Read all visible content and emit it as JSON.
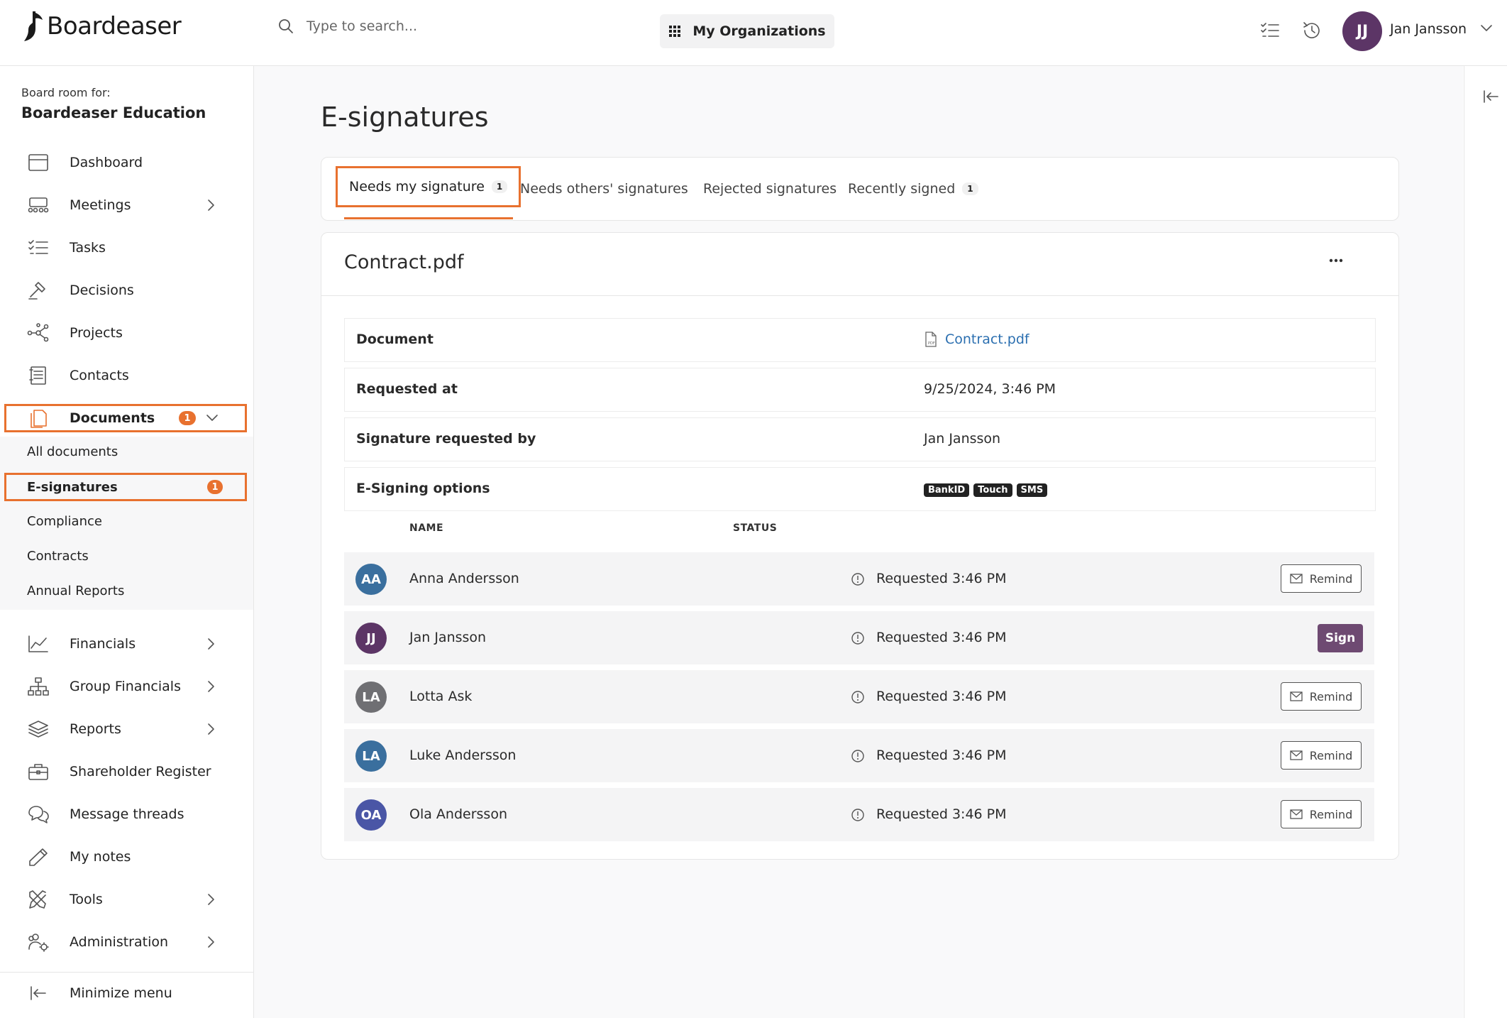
{
  "app": {
    "brand": "Boardeaser"
  },
  "header": {
    "search_placeholder": "Type to search...",
    "org_button": "My Organizations",
    "user": {
      "initials": "JJ",
      "name": "Jan Jansson",
      "avatar_color": "#5c3566"
    }
  },
  "sidebar": {
    "board_for_label": "Board room for:",
    "board_name": "Boardeaser Education",
    "items": [
      {
        "label": "Dashboard",
        "icon": "calendar-icon"
      },
      {
        "label": "Meetings",
        "icon": "meeting-icon",
        "expandable": true
      },
      {
        "label": "Tasks",
        "icon": "checklist-icon"
      },
      {
        "label": "Decisions",
        "icon": "gavel-icon"
      },
      {
        "label": "Projects",
        "icon": "network-icon"
      },
      {
        "label": "Contacts",
        "icon": "address-book-icon"
      },
      {
        "label": "Documents",
        "icon": "documents-icon",
        "badge": "1",
        "expanded": true,
        "selected": true
      },
      {
        "label": "Financials",
        "icon": "line-chart-icon",
        "expandable": true
      },
      {
        "label": "Group Financials",
        "icon": "org-chart-icon",
        "expandable": true
      },
      {
        "label": "Reports",
        "icon": "layers-icon",
        "expandable": true
      },
      {
        "label": "Shareholder Register",
        "icon": "briefcase-icon"
      },
      {
        "label": "Message threads",
        "icon": "chat-icon"
      },
      {
        "label": "My notes",
        "icon": "pencil-icon"
      },
      {
        "label": "Tools",
        "icon": "tools-icon",
        "expandable": true
      },
      {
        "label": "Administration",
        "icon": "users-gear-icon",
        "expandable": true
      }
    ],
    "documents_sub": [
      {
        "label": "All documents"
      },
      {
        "label": "E-signatures",
        "badge": "1",
        "selected": true
      },
      {
        "label": "Compliance"
      },
      {
        "label": "Contracts"
      },
      {
        "label": "Annual Reports"
      }
    ],
    "minimize_label": "Minimize menu"
  },
  "main": {
    "title": "E-signatures",
    "tabs": [
      {
        "label": "Needs my signature",
        "count": "1",
        "active": true
      },
      {
        "label": "Needs others' signatures"
      },
      {
        "label": "Rejected signatures"
      },
      {
        "label": "Recently signed",
        "count": "1"
      }
    ],
    "document": {
      "title": "Contract.pdf",
      "info": [
        {
          "key": "Document",
          "value": "Contract.pdf"
        },
        {
          "key": "Requested at",
          "value": "9/25/2024, 3:46 PM"
        },
        {
          "key": "Signature requested by",
          "value": "Jan Jansson"
        },
        {
          "key": "E-Signing options",
          "value": ""
        }
      ],
      "signing_options": [
        "BankID",
        "Touch",
        "SMS"
      ],
      "columns": {
        "name": "NAME",
        "status": "STATUS"
      },
      "signers": [
        {
          "initials": "AA",
          "name": "Anna Andersson",
          "status": "Requested 3:46 PM",
          "action": "Remind",
          "color": "#3a6f9e"
        },
        {
          "initials": "JJ",
          "name": "Jan Jansson",
          "status": "Requested 3:46 PM",
          "action": "Sign",
          "color": "#5c3566"
        },
        {
          "initials": "LA",
          "name": "Lotta Ask",
          "status": "Requested 3:46 PM",
          "action": "Remind",
          "color": "#6f6f73"
        },
        {
          "initials": "LA",
          "name": "Luke Andersson",
          "status": "Requested 3:46 PM",
          "action": "Remind",
          "color": "#3a6f9e"
        },
        {
          "initials": "OA",
          "name": "Ola Andersson",
          "status": "Requested 3:46 PM",
          "action": "Remind",
          "color": "#4a56a6"
        }
      ]
    }
  },
  "colors": {
    "accent_orange": "#e8712f",
    "sign_button": "#6e4a72",
    "link_blue": "#2b6fb0"
  }
}
